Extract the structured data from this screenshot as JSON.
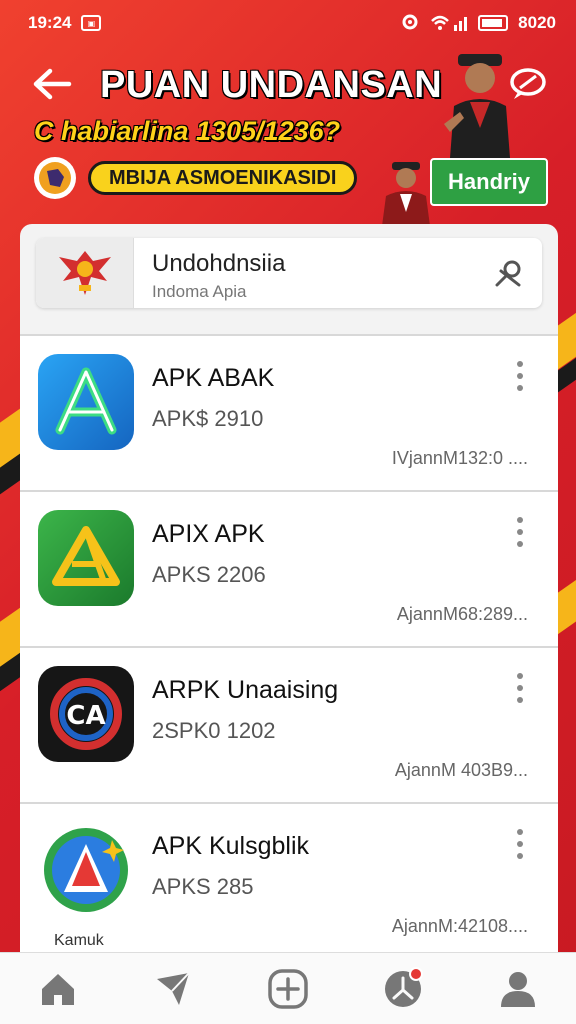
{
  "status_bar": {
    "time": "19:24",
    "right_text": "8020"
  },
  "header": {
    "title": "PUAN  UNDANSAN",
    "subtitle": "C habiarlina 1305/1236?",
    "promo_label": "MBIJA ASMOENIKASIDI",
    "handy_button": "Handriy"
  },
  "search": {
    "title": "Undohdnsiia",
    "subtitle": "Indoma Apia"
  },
  "apps": [
    {
      "name": "APK  ABAK",
      "version": "APK$  2910",
      "meta": "IVjannM132:0 ....",
      "icon": "app-store-a-icon",
      "color": "#1e88e5"
    },
    {
      "name": "APIX APK",
      "version": "APKS  2206",
      "meta": "AjannM68:289...",
      "icon": "triangle-a-icon",
      "color": "#2e9d3a"
    },
    {
      "name": "ARPK Unaaising",
      "version": "2SPK0  1202",
      "meta": "AjannM 403B9...",
      "icon": "ca-logo-icon",
      "color": "#161616"
    },
    {
      "name": "APK Kulsgblik",
      "version": "APKS  285",
      "meta": "AjannM:42108....",
      "icon": "globe-a-icon",
      "color": "#2fa24a",
      "caption": "Kamuk"
    }
  ],
  "bottom_nav": [
    {
      "icon": "home-icon"
    },
    {
      "icon": "send-icon"
    },
    {
      "icon": "add-icon"
    },
    {
      "icon": "notifications-icon"
    },
    {
      "icon": "profile-icon"
    }
  ]
}
